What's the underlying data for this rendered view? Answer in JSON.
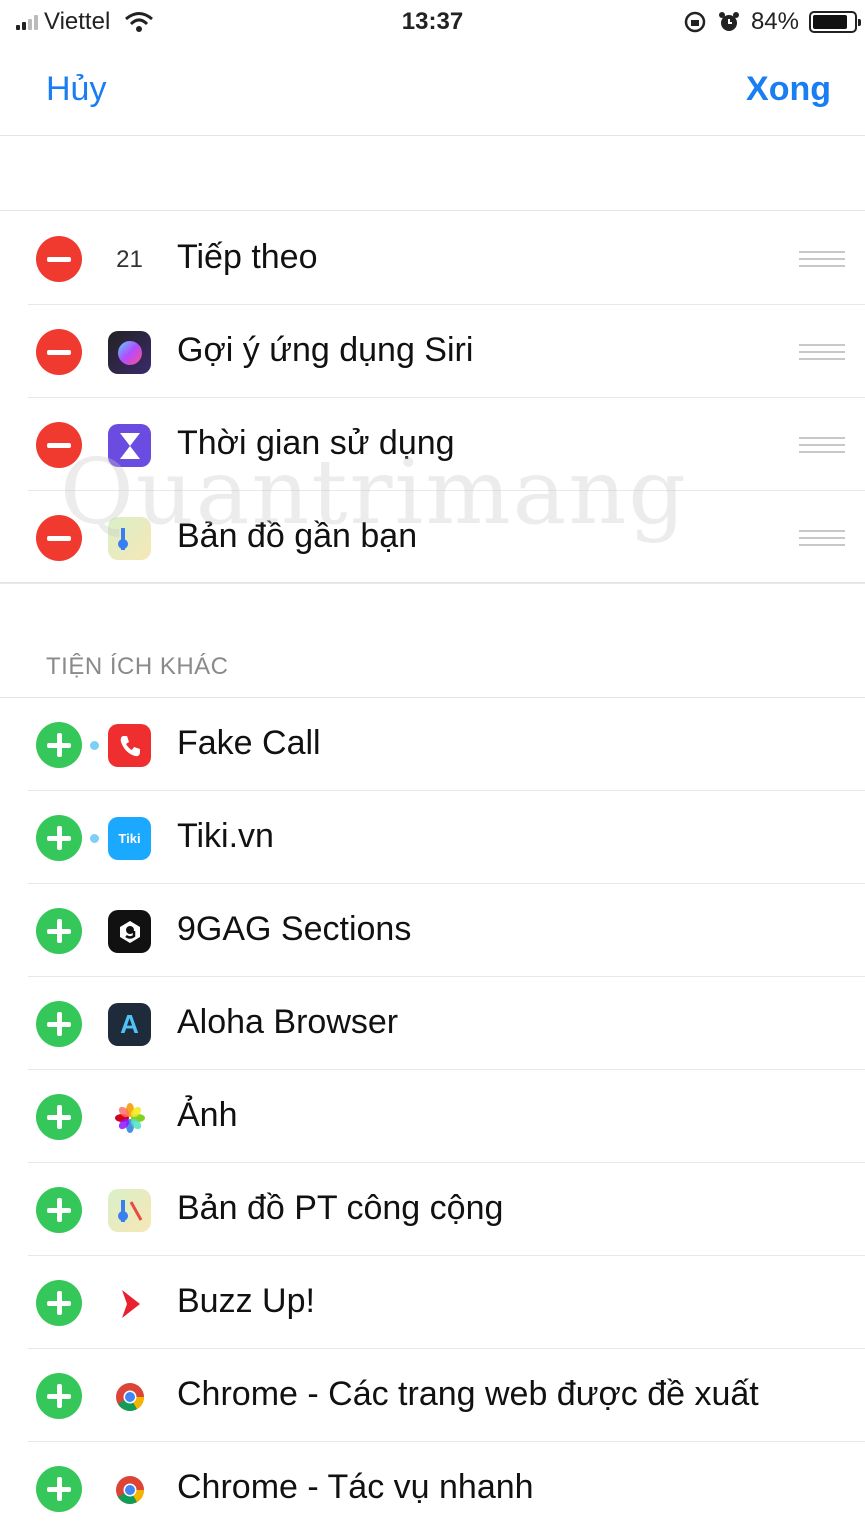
{
  "status_bar": {
    "carrier": "Viettel",
    "time": "13:37",
    "battery": "84%",
    "battery_level": 0.84
  },
  "nav": {
    "cancel_label": "Hủy",
    "done_label": "Xong"
  },
  "active_widgets": [
    {
      "label": "Tiếp theo",
      "icon": "calendar-icon",
      "icon_text": "21"
    },
    {
      "label": "Gợi ý ứng dụng Siri",
      "icon": "siri-icon"
    },
    {
      "label": "Thời gian sử dụng",
      "icon": "screen-time-icon"
    },
    {
      "label": "Bản đồ gần bạn",
      "icon": "maps-icon"
    }
  ],
  "more_section": {
    "title": "TIỆN ÍCH KHÁC",
    "items": [
      {
        "label": "Fake Call",
        "icon": "phone-icon",
        "new": true
      },
      {
        "label": "Tiki.vn",
        "icon": "tiki-icon",
        "icon_text": "Tiki",
        "new": true
      },
      {
        "label": "9GAG Sections",
        "icon": "9gag-icon"
      },
      {
        "label": "Aloha Browser",
        "icon": "aloha-icon",
        "icon_text": "A"
      },
      {
        "label": "Ảnh",
        "icon": "photos-icon"
      },
      {
        "label": "Bản đồ PT công cộng",
        "icon": "maps-icon"
      },
      {
        "label": "Buzz Up!",
        "icon": "buzz-icon"
      },
      {
        "label": "Chrome - Các trang web được đề xuất",
        "icon": "chrome-icon"
      },
      {
        "label": "Chrome - Tác vụ nhanh",
        "icon": "chrome-icon"
      }
    ]
  },
  "watermark": "Quantrimang",
  "colors": {
    "accent": "#1a7df2",
    "remove": "#f03a30",
    "add": "#35c759"
  }
}
